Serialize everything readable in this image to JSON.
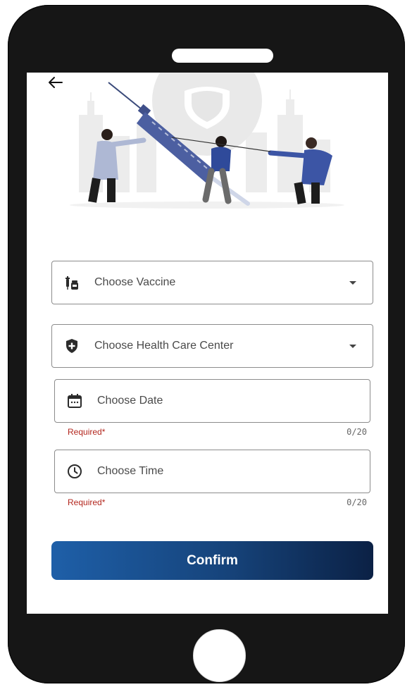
{
  "form": {
    "vaccine": {
      "label": "Choose Vaccine",
      "icon": "vaccine-icon"
    },
    "health_center": {
      "label": "Choose Health Care Center",
      "icon": "shield-plus-icon"
    },
    "date": {
      "label": "Choose Date",
      "icon": "calendar-icon",
      "helper": "Required*",
      "counter": "0/20"
    },
    "time": {
      "label": "Choose Time",
      "icon": "clock-icon",
      "helper": "Required*",
      "counter": "0/20"
    },
    "confirm_label": "Confirm"
  },
  "colors": {
    "primary_start": "#1e5fa8",
    "primary_end": "#0b2145",
    "error": "#b3261e",
    "border": "#8c8c8c"
  }
}
